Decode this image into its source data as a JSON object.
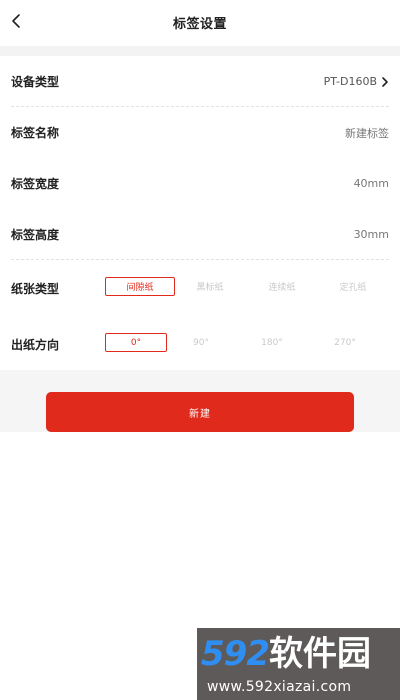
{
  "header": {
    "title": "标签设置"
  },
  "settings": {
    "device_type": {
      "label": "设备类型",
      "value": "PT-D160B"
    },
    "label_name": {
      "label": "标签名称",
      "value": "新建标签"
    },
    "label_width": {
      "label": "标签宽度",
      "value": "40mm"
    },
    "label_height": {
      "label": "标签高度",
      "value": "30mm"
    }
  },
  "paper_type": {
    "label": "纸张类型",
    "options": [
      "间隙纸",
      "黑标纸",
      "连续纸",
      "定孔纸"
    ],
    "selected": "间隙纸"
  },
  "orientation": {
    "label": "出纸方向",
    "options": [
      "0°",
      "90°",
      "180°",
      "270°"
    ],
    "selected": "0°"
  },
  "actions": {
    "create_label": "新建"
  },
  "watermark": {
    "number": "592",
    "name": "软件园",
    "url": "www.592xiazai.com"
  },
  "colors": {
    "accent": "#e02a1c",
    "watermark_blue": "#2f8ef2"
  },
  "icons": {
    "back": "chevron-left-icon",
    "device_more": "chevron-right-icon"
  }
}
